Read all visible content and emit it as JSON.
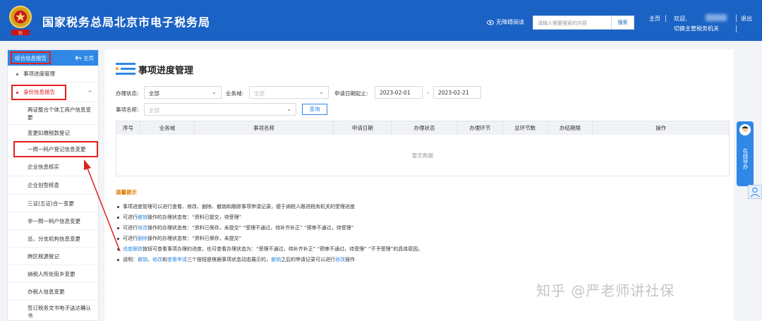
{
  "header": {
    "site_title": "国家税务总局北京市电子税务局",
    "emblem_text": "税",
    "accessibility_label": "无障碍阅读",
    "search_placeholder": "请输入需要搜索的内容",
    "search_button": "搜索",
    "home_link": "主页",
    "welcome": "欢迎,",
    "logout": "退出",
    "switch_org": "切换主管税务机关"
  },
  "sidebar": {
    "title": "综合信息报告",
    "home": "主页",
    "items": [
      {
        "label": "事项进度管理",
        "level": 1
      },
      {
        "label": "身份信息报告",
        "level": 1,
        "active": true
      },
      {
        "label": "两证整合个体工商户信息变更",
        "level": 2
      },
      {
        "label": "变更扣缴税款登记",
        "level": 2
      },
      {
        "label": "一照一码户登记信息变更",
        "level": 2
      },
      {
        "label": "企业信息核实",
        "level": 2
      },
      {
        "label": "企业划型核查",
        "level": 2
      },
      {
        "label": "三证(五证)合一变更",
        "level": 2
      },
      {
        "label": "非一照一码户信息变更",
        "level": 2
      },
      {
        "label": "总、分支机构信息变更",
        "level": 2
      },
      {
        "label": "跨区税源登记",
        "level": 2
      },
      {
        "label": "纳税人所处街乡变更",
        "level": 2
      },
      {
        "label": "办税人信息变更",
        "level": 2
      },
      {
        "label": "签订税务文书电子送达确认书",
        "level": 2
      }
    ]
  },
  "main": {
    "page_title": "事项进度管理",
    "filters": {
      "status_label": "办理状态:",
      "status_value": "全部",
      "domain_label": "业务域:",
      "domain_value": "全部",
      "date_label": "申请日期起止:",
      "date_from": "2023-02-01",
      "date_sep": "-",
      "date_to": "2023-02-21",
      "name_label": "事项名称:",
      "name_value": "全部",
      "query_button": "查询"
    },
    "table": {
      "columns": [
        "序号",
        "业务域",
        "事项名称",
        "申请日期",
        "办理状态",
        "办理环节",
        "总环节数",
        "办结期限",
        "操作"
      ],
      "empty_text": "暂无数据"
    },
    "tips": {
      "title": "温馨提示",
      "lines": [
        [
          {
            "t": "事项进度管理可以进行查看、修改、删除、撤销和跟踪事项申请记录，便于纳税人跟进税务机关的受理进度"
          }
        ],
        [
          {
            "t": "可进行"
          },
          {
            "t": "撤销",
            "link": true
          },
          {
            "t": "操作的办理状态有：“资料已提交，待受理”"
          }
        ],
        [
          {
            "t": "可进行"
          },
          {
            "t": "修改",
            "link": true
          },
          {
            "t": "操作的办理状态有：“资料已保存，未提交”  “受理不通过，待补齐补正”  “预审不通过，待受理”"
          }
        ],
        [
          {
            "t": "可进行"
          },
          {
            "t": "删除",
            "link": true
          },
          {
            "t": "操作的办理状态有：“资料已保存，未提交”"
          }
        ],
        [
          {
            "t": "进度跟踪",
            "link": true
          },
          {
            "t": "按钮可查看事项办理的进度，也可查看办理状态为：“受理不通过，待补齐补正”  “预审不通过，待受理”  “不予受理”的具体原因。"
          }
        ],
        [
          {
            "t": "说明："
          },
          {
            "t": "撤销",
            "link": true
          },
          {
            "t": "、"
          },
          {
            "t": "修改",
            "link": true
          },
          {
            "t": "和"
          },
          {
            "t": "查看申请",
            "link": true
          },
          {
            "t": "三个按钮是根据事项状态动态展示的，"
          },
          {
            "t": "撤销",
            "link": true
          },
          {
            "t": "之后的申请记录可以进行"
          },
          {
            "t": "修改",
            "link": true
          },
          {
            "t": "操作"
          }
        ]
      ]
    }
  },
  "float_guide": {
    "text": "在线导办"
  },
  "watermark": "知乎 @严老师讲社保",
  "colors": {
    "header_blue": "#1a62c4",
    "accent_blue": "#2f88e5",
    "highlight_red": "#e02020",
    "tip_orange": "#e07a00"
  }
}
